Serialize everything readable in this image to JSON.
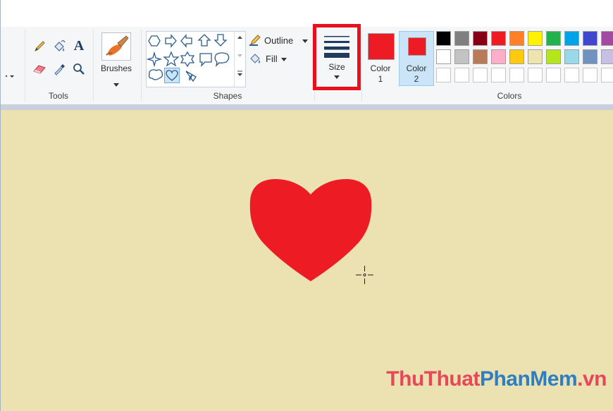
{
  "ribbon": {
    "groups": {
      "tools_label": "Tools",
      "shapes_label": "Shapes",
      "colors_label": "Colors"
    },
    "tools": [
      {
        "name": "pencil-icon"
      },
      {
        "name": "fill-bucket-icon"
      },
      {
        "name": "text-tool-icon",
        "glyph": "A"
      },
      {
        "name": "eraser-icon"
      },
      {
        "name": "color-picker-icon"
      },
      {
        "name": "magnifier-icon"
      }
    ],
    "brushes_label": "Brushes",
    "outline_label": "Outline",
    "fill_label": "Fill",
    "size_label": "Size",
    "color1_label": "Color\n1",
    "color1_line1": "Color",
    "color1_line2": "1",
    "color2_line1": "Color",
    "color2_line2": "2",
    "color1_value": "#ed1c24",
    "color2_value": "#ed1c24",
    "highlight_color": "#e8101c",
    "palette_row1": [
      "#000000",
      "#7f7f7f",
      "#880015",
      "#ed1c24",
      "#ff7f27",
      "#fff200",
      "#22b14c",
      "#00a2e8",
      "#3f48cc",
      "#a349a4"
    ],
    "palette_row2": [
      "#ffffff",
      "#c3c3c3",
      "#b97a57",
      "#ffaec9",
      "#ffc90e",
      "#efe4b0",
      "#b5e61d",
      "#99d9ea",
      "#7092be",
      "#c8bfe7"
    ]
  },
  "canvas": {
    "background": "#ece1b0",
    "heart_color": "#ed1c24"
  },
  "watermark": {
    "part1": "ThuThuat",
    "part2": "PhanMem",
    "part3": ".vn"
  }
}
